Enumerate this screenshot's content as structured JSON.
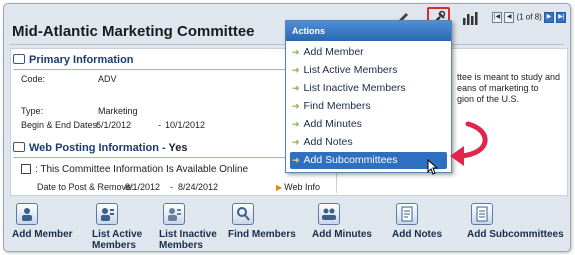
{
  "header": {
    "title": "Mid-Atlantic Marketing Committee"
  },
  "top_icons": [
    "pencil-icon",
    "tools-icon",
    "bar-chart-icon"
  ],
  "pager": {
    "label": "(1 of 8)"
  },
  "primary": {
    "section": "Primary Information",
    "code_label": "Code:",
    "code_value": "ADV",
    "type_label": "Type:",
    "type_value": "Marketing",
    "dates_label": "Begin & End Dates:",
    "begin_date": "6/1/2012",
    "dash": "-",
    "end_date": "10/1/2012",
    "desc_line1": "ttee is meant to study and",
    "desc_line2": "eans of marketing to",
    "desc_line3": "gion of the U.S."
  },
  "web": {
    "section": "Web Posting Information -",
    "yes": "Yes",
    "available": ": This Committee Information Is Available Online",
    "post_label": "Date to Post & Remove:",
    "post_begin": "8/1/2012",
    "post_dash": "-",
    "post_end": "8/24/2012",
    "web_info": "Web Info"
  },
  "toolbar": [
    {
      "label": "Add Member",
      "icon": "add-member-icon"
    },
    {
      "label": "List Active Members",
      "icon": "list-active-icon"
    },
    {
      "label": "List Inactive Members",
      "icon": "list-inactive-icon"
    },
    {
      "label": "Find Members",
      "icon": "find-members-icon"
    },
    {
      "label": "Add Minutes",
      "icon": "add-minutes-icon"
    },
    {
      "label": "Add Notes",
      "icon": "add-notes-icon"
    },
    {
      "label": "Add Subcommittees",
      "icon": "add-subcommittees-icon"
    }
  ],
  "actions_menu": {
    "header": "Actions",
    "items": [
      "Add Member",
      "List Active Members",
      "List Inactive Members",
      "Find Members",
      "Add Minutes",
      "Add Notes",
      "Add Subcommittees"
    ],
    "selected": "Add Subcommittees"
  },
  "colors": {
    "accent": "#2f6fc0",
    "highlight_box": "#d92b2b",
    "annotation_arrow": "#e0264e"
  }
}
